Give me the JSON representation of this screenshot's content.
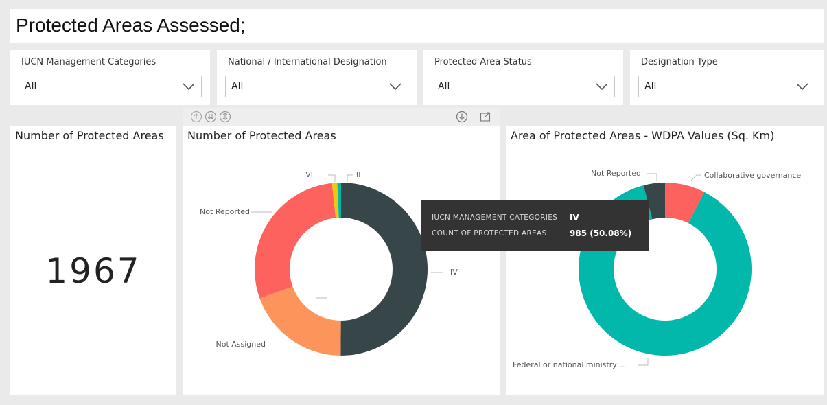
{
  "page_title": "Protected Areas Assessed;",
  "slicers": [
    {
      "label": "IUCN Management Categories",
      "value": "All"
    },
    {
      "label": "National / International Designation",
      "value": "All"
    },
    {
      "label": "Protected Area Status",
      "value": "All"
    },
    {
      "label": "Designation Type",
      "value": "All"
    }
  ],
  "toolbar": {
    "icons": [
      "drill-up-icon",
      "drill-down-all-icon",
      "expand-hierarchy-icon",
      "drill-mode-icon",
      "focus-mode-icon"
    ]
  },
  "card": {
    "title": "Number of Protected Areas",
    "value": "1967"
  },
  "tooltip": {
    "row1_key": "IUCN MANAGEMENT CATEGORIES",
    "row1_value": "IV",
    "row2_key": "COUNT OF PROTECTED AREAS",
    "row2_value": "985 (50.08%)"
  },
  "chart_data": [
    {
      "type": "pie",
      "variant": "donut",
      "title": "Number of Protected Areas",
      "categories": [
        "IV",
        "Not Assigned",
        "Not Reported",
        "VI",
        "II"
      ],
      "values": [
        985,
        382,
        567,
        19,
        14
      ],
      "colors": [
        "#374649",
        "#FD945C",
        "#FD625E",
        "#F2C80F",
        "#01B8AA"
      ],
      "labels_shown": [
        "VI",
        "II",
        "Not Reported",
        "IV",
        "Not Assigned"
      ]
    },
    {
      "type": "pie",
      "variant": "donut",
      "title": "Area of Protected Areas - WDPA Values (Sq. Km)",
      "categories": [
        "Collaborative governance",
        "Federal or national ministry ...",
        "Not Reported"
      ],
      "values": [
        7.5,
        88.5,
        4.0
      ],
      "colors": [
        "#FD625E",
        "#01B8AA",
        "#374649"
      ]
    }
  ]
}
